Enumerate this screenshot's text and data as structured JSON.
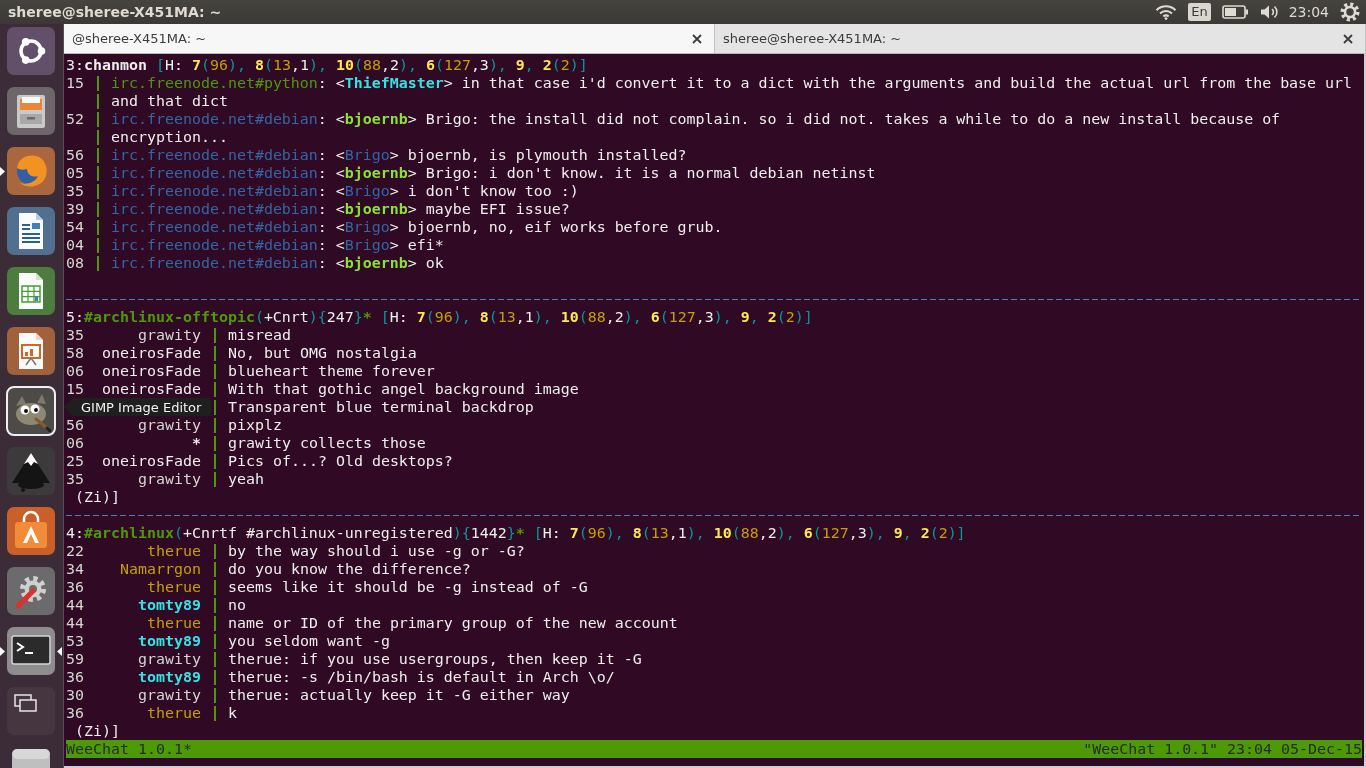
{
  "top_panel": {
    "title": "sheree@sheree-X451MA: ~",
    "keyboard_layout": "En",
    "clock": "23:04"
  },
  "launcher": {
    "items": [
      {
        "kind": "dash",
        "running": false,
        "focused": false,
        "hovered": false
      },
      {
        "kind": "files",
        "running": false,
        "focused": false,
        "hovered": false
      },
      {
        "kind": "browser",
        "running": true,
        "focused": false,
        "hovered": false
      },
      {
        "kind": "writer",
        "running": false,
        "focused": false,
        "hovered": false
      },
      {
        "kind": "calc",
        "running": false,
        "focused": false,
        "hovered": false
      },
      {
        "kind": "impress",
        "running": false,
        "focused": false,
        "hovered": false
      },
      {
        "kind": "gimp",
        "running": false,
        "focused": false,
        "hovered": true
      },
      {
        "kind": "inkscape",
        "running": false,
        "focused": false,
        "hovered": false
      },
      {
        "kind": "software",
        "running": false,
        "focused": false,
        "hovered": false
      },
      {
        "kind": "settings",
        "running": false,
        "focused": false,
        "hovered": false
      },
      {
        "kind": "terminal",
        "running": true,
        "focused": true,
        "hovered": false
      },
      {
        "kind": "workspaces",
        "running": false,
        "focused": false,
        "hovered": false
      },
      {
        "kind": "drive",
        "running": false,
        "focused": false,
        "hovered": false
      }
    ],
    "tooltip": "GIMP Image Editor"
  },
  "tabs": [
    {
      "label": "@sheree-X451MA: ~",
      "selected": true
    },
    {
      "label": "sheree@sheree-X451MA: ~",
      "selected": false
    }
  ],
  "terminal": {
    "windows": [
      {
        "header": [
          {
            "text": "3:",
            "color": "#eeeeec"
          },
          {
            "text": "chanmon",
            "color": "#eeeeec",
            "bold": true
          },
          {
            "text": " [",
            "color": "#06989a"
          },
          {
            "text": "H: ",
            "color": "#eeeeec"
          },
          {
            "text": "7",
            "color": "#fce94f",
            "bold": true
          },
          {
            "text": "(",
            "color": "#06989a"
          },
          {
            "text": "96",
            "color": "#c4a000"
          },
          {
            "text": "), ",
            "color": "#06989a"
          },
          {
            "text": "8",
            "color": "#fce94f",
            "bold": true
          },
          {
            "text": "(",
            "color": "#06989a"
          },
          {
            "text": "13",
            "color": "#c4a000"
          },
          {
            "text": ",1",
            "color": "#eeeeec"
          },
          {
            "text": "), ",
            "color": "#06989a"
          },
          {
            "text": "10",
            "color": "#fce94f",
            "bold": true
          },
          {
            "text": "(",
            "color": "#06989a"
          },
          {
            "text": "88",
            "color": "#c4a000"
          },
          {
            "text": ",2",
            "color": "#eeeeec"
          },
          {
            "text": "), ",
            "color": "#06989a"
          },
          {
            "text": "6",
            "color": "#fce94f",
            "bold": true
          },
          {
            "text": "(",
            "color": "#06989a"
          },
          {
            "text": "127",
            "color": "#c4a000"
          },
          {
            "text": ",3",
            "color": "#eeeeec"
          },
          {
            "text": "), ",
            "color": "#06989a"
          },
          {
            "text": "9",
            "color": "#fce94f",
            "bold": true
          },
          {
            "text": ", ",
            "color": "#06989a"
          },
          {
            "text": "2",
            "color": "#fce94f",
            "bold": true
          },
          {
            "text": "(",
            "color": "#06989a"
          },
          {
            "text": "2",
            "color": "#c4a000"
          },
          {
            "text": ")]",
            "color": "#06989a"
          }
        ],
        "lines": [
          {
            "kind": "monitor",
            "time": "15",
            "segments": [
              {
                "text": "irc.freenode.net#python",
                "color": "#4e9a06"
              },
              {
                "text": ": <",
                "color": "#eeeeec"
              },
              {
                "text": "ThiefMaster",
                "color": "#34e2e2",
                "bold": true
              },
              {
                "text": "> in that case i'd convert it to a dict with the arguments and build the actual url from the base url",
                "color": "#eeeeec"
              }
            ],
            "wrapped": [
              "and that dict"
            ]
          },
          {
            "kind": "monitor",
            "time": "52",
            "segments": [
              {
                "text": "irc.freenode.net#debian",
                "color": "#3465a4"
              },
              {
                "text": ": <",
                "color": "#eeeeec"
              },
              {
                "text": "bjoernb",
                "color": "#8ae234",
                "bold": true
              },
              {
                "text": "> Brigo: the install did not complain. so i did not. takes a while to do a new install because of",
                "color": "#eeeeec"
              }
            ],
            "wrapped": [
              "encryption..."
            ]
          },
          {
            "kind": "monitor",
            "time": "56",
            "segments": [
              {
                "text": "irc.freenode.net#debian",
                "color": "#3465a4"
              },
              {
                "text": ": <",
                "color": "#eeeeec"
              },
              {
                "text": "Brigo",
                "color": "#3465a4"
              },
              {
                "text": "> bjoernb, is plymouth installed?",
                "color": "#eeeeec"
              }
            ]
          },
          {
            "kind": "monitor",
            "time": "05",
            "segments": [
              {
                "text": "irc.freenode.net#debian",
                "color": "#3465a4"
              },
              {
                "text": ": <",
                "color": "#eeeeec"
              },
              {
                "text": "bjoernb",
                "color": "#8ae234",
                "bold": true
              },
              {
                "text": "> Brigo: i don't know. it is a normal debian netinst",
                "color": "#eeeeec"
              }
            ]
          },
          {
            "kind": "monitor",
            "time": "35",
            "segments": [
              {
                "text": "irc.freenode.net#debian",
                "color": "#3465a4"
              },
              {
                "text": ": <",
                "color": "#eeeeec"
              },
              {
                "text": "Brigo",
                "color": "#3465a4"
              },
              {
                "text": "> i don't know too :)",
                "color": "#eeeeec"
              }
            ]
          },
          {
            "kind": "monitor",
            "time": "39",
            "segments": [
              {
                "text": "irc.freenode.net#debian",
                "color": "#3465a4"
              },
              {
                "text": ": <",
                "color": "#eeeeec"
              },
              {
                "text": "bjoernb",
                "color": "#8ae234",
                "bold": true
              },
              {
                "text": "> maybe EFI issue?",
                "color": "#eeeeec"
              }
            ]
          },
          {
            "kind": "monitor",
            "time": "54",
            "segments": [
              {
                "text": "irc.freenode.net#debian",
                "color": "#3465a4"
              },
              {
                "text": ": <",
                "color": "#eeeeec"
              },
              {
                "text": "Brigo",
                "color": "#3465a4"
              },
              {
                "text": "> bjoernb, no, eif works before grub.",
                "color": "#eeeeec"
              }
            ]
          },
          {
            "kind": "monitor",
            "time": "04",
            "segments": [
              {
                "text": "irc.freenode.net#debian",
                "color": "#3465a4"
              },
              {
                "text": ": <",
                "color": "#eeeeec"
              },
              {
                "text": "Brigo",
                "color": "#3465a4"
              },
              {
                "text": "> efi*",
                "color": "#eeeeec"
              }
            ]
          },
          {
            "kind": "monitor",
            "time": "08",
            "segments": [
              {
                "text": "irc.freenode.net#debian",
                "color": "#3465a4"
              },
              {
                "text": ": <",
                "color": "#eeeeec"
              },
              {
                "text": "bjoernb",
                "color": "#8ae234",
                "bold": true
              },
              {
                "text": "> ok",
                "color": "#eeeeec"
              }
            ]
          }
        ]
      },
      {
        "header": [
          {
            "text": "5:",
            "color": "#eeeeec"
          },
          {
            "text": "#archlinux-offtopic",
            "color": "#4e9a06",
            "bold": true
          },
          {
            "text": "(",
            "color": "#06989a"
          },
          {
            "text": "+Cnrt",
            "color": "#eeeeec"
          },
          {
            "text": "){",
            "color": "#06989a"
          },
          {
            "text": "247",
            "color": "#eeeeec"
          },
          {
            "text": "}",
            "color": "#06989a"
          },
          {
            "text": "*",
            "color": "#4e9a06",
            "bold": true
          },
          {
            "text": " [",
            "color": "#06989a"
          },
          {
            "text": "H: ",
            "color": "#eeeeec"
          },
          {
            "text": "7",
            "color": "#fce94f",
            "bold": true
          },
          {
            "text": "(",
            "color": "#06989a"
          },
          {
            "text": "96",
            "color": "#c4a000"
          },
          {
            "text": "), ",
            "color": "#06989a"
          },
          {
            "text": "8",
            "color": "#fce94f",
            "bold": true
          },
          {
            "text": "(",
            "color": "#06989a"
          },
          {
            "text": "13",
            "color": "#c4a000"
          },
          {
            "text": ",1",
            "color": "#eeeeec"
          },
          {
            "text": "), ",
            "color": "#06989a"
          },
          {
            "text": "10",
            "color": "#fce94f",
            "bold": true
          },
          {
            "text": "(",
            "color": "#06989a"
          },
          {
            "text": "88",
            "color": "#c4a000"
          },
          {
            "text": ",2",
            "color": "#eeeeec"
          },
          {
            "text": "), ",
            "color": "#06989a"
          },
          {
            "text": "6",
            "color": "#fce94f",
            "bold": true
          },
          {
            "text": "(",
            "color": "#06989a"
          },
          {
            "text": "127",
            "color": "#c4a000"
          },
          {
            "text": ",3",
            "color": "#eeeeec"
          },
          {
            "text": "), ",
            "color": "#06989a"
          },
          {
            "text": "9",
            "color": "#fce94f",
            "bold": true
          },
          {
            "text": ", ",
            "color": "#06989a"
          },
          {
            "text": "2",
            "color": "#fce94f",
            "bold": true
          },
          {
            "text": "(",
            "color": "#06989a"
          },
          {
            "text": "2",
            "color": "#c4a000"
          },
          {
            "text": ")]",
            "color": "#06989a"
          }
        ],
        "lines": [
          {
            "kind": "chat",
            "time": "35",
            "nick": "grawity",
            "color": "#d3d7cf",
            "bold": false,
            "text": "misread"
          },
          {
            "kind": "chat",
            "time": "58",
            "nick": "oneirosFade",
            "color": "#eeeeec",
            "bold": false,
            "text": "No, but OMG nostalgia"
          },
          {
            "kind": "chat",
            "time": "06",
            "nick": "oneirosFade",
            "color": "#eeeeec",
            "bold": false,
            "text": "blueheart theme forever"
          },
          {
            "kind": "chat",
            "time": "15",
            "nick": "oneirosFade",
            "color": "#eeeeec",
            "bold": false,
            "text": "With that gothic angel background image"
          },
          {
            "kind": "chat",
            "text": "Transparent blue terminal backdrop"
          },
          {
            "kind": "chat",
            "time": "56",
            "nick": "grawity",
            "color": "#d3d7cf",
            "bold": false,
            "text": "pixplz"
          },
          {
            "kind": "chat",
            "time": "06",
            "nick": "*",
            "color": "#eeeeec",
            "bold": true,
            "text": "grawity collects those"
          },
          {
            "kind": "chat",
            "time": "25",
            "nick": "oneirosFade",
            "color": "#eeeeec",
            "bold": false,
            "text": "Pics of...? Old desktops?"
          },
          {
            "kind": "chat",
            "time": "35",
            "nick": "grawity",
            "color": "#d3d7cf",
            "bold": false,
            "text": "yeah"
          }
        ],
        "input": "(Zi)]"
      },
      {
        "header": [
          {
            "text": "4:",
            "color": "#eeeeec"
          },
          {
            "text": "#archlinux",
            "color": "#4e9a06",
            "bold": true
          },
          {
            "text": "(",
            "color": "#06989a"
          },
          {
            "text": "+Cnrtf #archlinux-unregistered",
            "color": "#eeeeec"
          },
          {
            "text": "){",
            "color": "#06989a"
          },
          {
            "text": "1442",
            "color": "#eeeeec"
          },
          {
            "text": "}",
            "color": "#06989a"
          },
          {
            "text": "*",
            "color": "#4e9a06",
            "bold": true
          },
          {
            "text": " [",
            "color": "#06989a"
          },
          {
            "text": "H: ",
            "color": "#eeeeec"
          },
          {
            "text": "7",
            "color": "#fce94f",
            "bold": true
          },
          {
            "text": "(",
            "color": "#06989a"
          },
          {
            "text": "96",
            "color": "#c4a000"
          },
          {
            "text": "), ",
            "color": "#06989a"
          },
          {
            "text": "8",
            "color": "#fce94f",
            "bold": true
          },
          {
            "text": "(",
            "color": "#06989a"
          },
          {
            "text": "13",
            "color": "#c4a000"
          },
          {
            "text": ",1",
            "color": "#eeeeec"
          },
          {
            "text": "), ",
            "color": "#06989a"
          },
          {
            "text": "10",
            "color": "#fce94f",
            "bold": true
          },
          {
            "text": "(",
            "color": "#06989a"
          },
          {
            "text": "88",
            "color": "#c4a000"
          },
          {
            "text": ",2",
            "color": "#eeeeec"
          },
          {
            "text": "), ",
            "color": "#06989a"
          },
          {
            "text": "6",
            "color": "#fce94f",
            "bold": true
          },
          {
            "text": "(",
            "color": "#06989a"
          },
          {
            "text": "127",
            "color": "#c4a000"
          },
          {
            "text": ",3",
            "color": "#eeeeec"
          },
          {
            "text": "), ",
            "color": "#06989a"
          },
          {
            "text": "9",
            "color": "#fce94f",
            "bold": true
          },
          {
            "text": ", ",
            "color": "#06989a"
          },
          {
            "text": "2",
            "color": "#fce94f",
            "bold": true
          },
          {
            "text": "(",
            "color": "#06989a"
          },
          {
            "text": "2",
            "color": "#c4a000"
          },
          {
            "text": ")]",
            "color": "#06989a"
          }
        ],
        "lines": [
          {
            "kind": "chat",
            "time": "22",
            "nick": "therue",
            "color": "#c4a000",
            "bold": false,
            "text": "by the way should i use -g or -G?"
          },
          {
            "kind": "chat",
            "time": "34",
            "nick": "Namarrgon",
            "color": "#c4a000",
            "bold": false,
            "text": "do you know the difference?"
          },
          {
            "kind": "chat",
            "time": "36",
            "nick": "therue",
            "color": "#c4a000",
            "bold": false,
            "text": "seems like it should be -g instead of -G"
          },
          {
            "kind": "chat",
            "time": "44",
            "nick": "tomty89",
            "color": "#34e2e2",
            "bold": true,
            "text": "no"
          },
          {
            "kind": "chat",
            "time": "44",
            "nick": "therue",
            "color": "#c4a000",
            "bold": false,
            "text": "name or ID of the primary group of the new account"
          },
          {
            "kind": "chat",
            "time": "53",
            "nick": "tomty89",
            "color": "#34e2e2",
            "bold": true,
            "text": "you seldom want -g"
          },
          {
            "kind": "chat",
            "time": "59",
            "nick": "grawity",
            "color": "#d3d7cf",
            "bold": false,
            "text": "therue: if you use usergroups, then keep it -G"
          },
          {
            "kind": "chat",
            "time": "36",
            "nick": "tomty89",
            "color": "#34e2e2",
            "bold": true,
            "text": "therue: -s /bin/bash is default in Arch \\o/"
          },
          {
            "kind": "chat",
            "time": "30",
            "nick": "grawity",
            "color": "#d3d7cf",
            "bold": false,
            "text": "therue: actually keep it -G either way"
          },
          {
            "kind": "chat",
            "time": "36",
            "nick": "therue",
            "color": "#c4a000",
            "bold": false,
            "text": "k"
          }
        ],
        "input": "(Zi)]"
      }
    ],
    "status_bar": {
      "left": "WeeChat 1.0.1*",
      "right": "\"WeeChat 1.0.1\" 23:04 05-Dec-15"
    }
  }
}
